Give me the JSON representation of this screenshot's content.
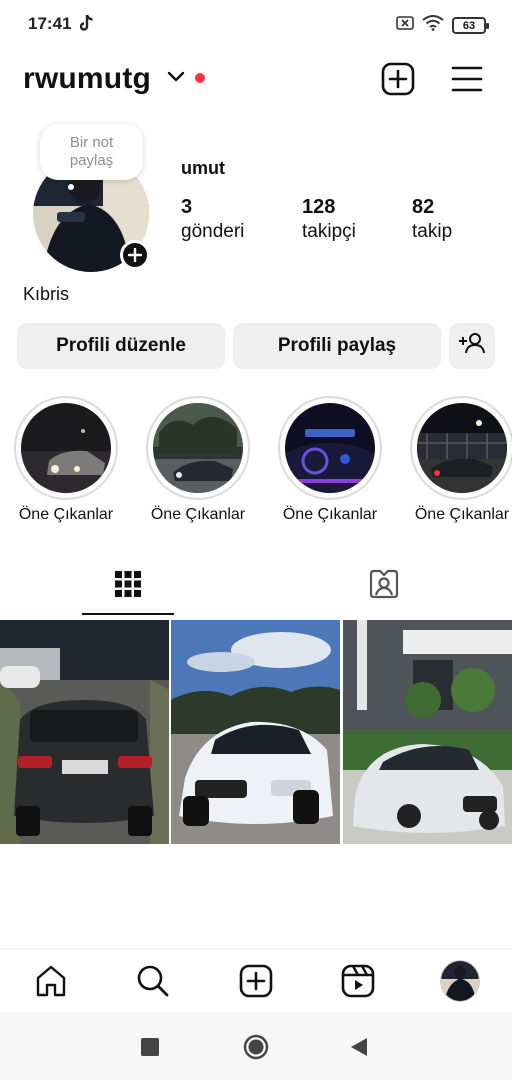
{
  "status": {
    "time": "17:41",
    "battery": "63"
  },
  "profile": {
    "username": "rwumutg",
    "display_name": "umut",
    "bio": "Kıbris",
    "note_line1": "Bir not",
    "note_line2": "paylaş",
    "stats": [
      {
        "value": "3",
        "label": "gönderi"
      },
      {
        "value": "128",
        "label": "takipçi"
      },
      {
        "value": "82",
        "label": "takip"
      }
    ]
  },
  "buttons": {
    "edit": "Profili düzenle",
    "share": "Profili paylaş"
  },
  "highlights": [
    {
      "label": "Öne Çıkanlar"
    },
    {
      "label": "Öne Çıkanlar"
    },
    {
      "label": "Öne Çıkanlar"
    },
    {
      "label": "Öne Çıkanlar"
    }
  ],
  "icons": {
    "status": [
      "tiktok-icon",
      "battery-saver-icon",
      "wifi-icon",
      "battery-icon"
    ],
    "header": [
      "chevron-down-icon",
      "notification-dot",
      "new-post-icon",
      "menu-icon"
    ],
    "tabs": [
      "grid-icon",
      "tagged-icon"
    ],
    "bottom_nav": [
      "home-icon",
      "search-icon",
      "create-icon",
      "reels-icon",
      "profile-avatar"
    ],
    "system_nav": [
      "recents-icon",
      "home-circle-icon",
      "back-icon"
    ]
  },
  "colors": {
    "notification_dot": "#ff3040",
    "button_bg": "#efefef",
    "text": "#111111"
  }
}
